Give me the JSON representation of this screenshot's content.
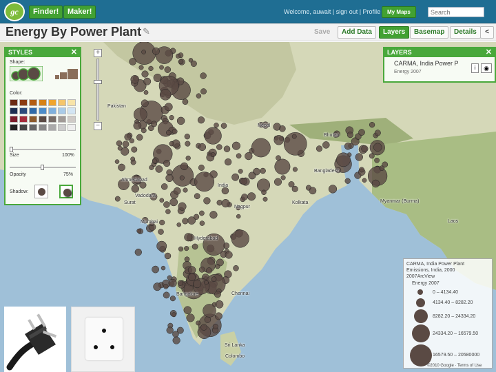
{
  "topbar": {
    "logo_text": "gc",
    "finder_label": "Finder!",
    "maker_label": "Maker!",
    "welcome_text": "Welcome, auwait | sign out | Profile",
    "mymaps_label": "My Maps",
    "search_placeholder": "Search"
  },
  "titlebar": {
    "title": "Energy By Power Plant",
    "save_label": "Save",
    "adddata_label": "Add Data",
    "layers_label": "Layers",
    "basemap_label": "Basemap",
    "details_label": "Details",
    "share_label": "<"
  },
  "styles_panel": {
    "title": "STYLES",
    "close": "✕",
    "shape_label": "Shape:",
    "color_label": "Color:",
    "size_label": "Size",
    "size_value": "100%",
    "opacity_label": "Opacity",
    "opacity_value": "75%",
    "shadow_label": "Shadow:",
    "size_level": 0.0,
    "opacity_level": 0.5,
    "swatches": [
      "#6b2a14",
      "#8a3a12",
      "#b35d12",
      "#d68216",
      "#f0a52d",
      "#f5c56a",
      "#f8e4a8",
      "#1d2e52",
      "#2c4a7c",
      "#2f6aa8",
      "#4c8cc9",
      "#7fb0dd",
      "#a9cbe8",
      "#d3e5f3",
      "#7a1c2a",
      "#a32b3a",
      "#8b5a2b",
      "#5a4a44",
      "#776d68",
      "#a09a96",
      "#cfcac6",
      "#222222",
      "#444444",
      "#666666",
      "#888888",
      "#aaaaaa",
      "#cccccc",
      "#eeeeee"
    ]
  },
  "layers_panel": {
    "title": "LAYERS",
    "close": "✕",
    "layer_name": "CARMA, India Power P",
    "layer_sub": "Energy 2007"
  },
  "legend": {
    "line1": "CARMA, India Power Plant",
    "line2": "Emissions, India, 2000",
    "line3": "2007ArcView",
    "attribute": "Energy 2007",
    "classes": [
      "0 – 4134.40",
      "4134.40 – 8282.20",
      "8282.20 – 24334.20",
      "24334.20 – 16579.50",
      "16579.50 – 20580000"
    ],
    "copyright": "©2010 Google · Terms of Use"
  },
  "places": [
    "Pakistan",
    "Nepal",
    "Bhutan",
    "India",
    "Bangladesh",
    "Myanmar (Burma)",
    "Laos",
    "Sri Lanka",
    "Colombo",
    "Chennai",
    "Hyderabad",
    "Nagpur",
    "Kolkata",
    "Mumbai",
    "Bangalore",
    "Surat",
    "Vadodara",
    "Ahmedabad"
  ],
  "colors": {
    "brand_green": "#42a132",
    "header_blue": "#1f6e93",
    "marker": "#5a4a44"
  }
}
